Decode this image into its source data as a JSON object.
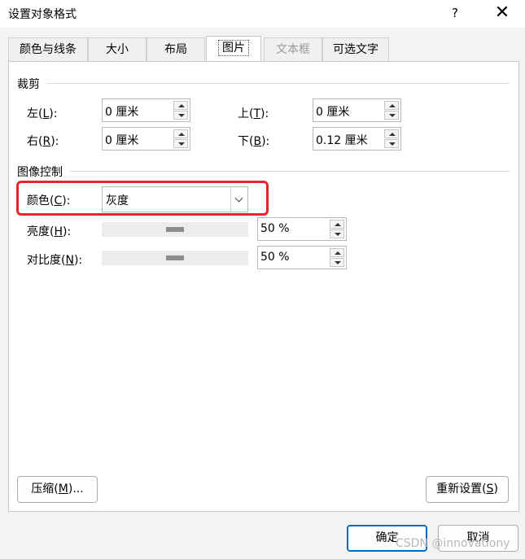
{
  "window": {
    "title": "设置对象格式",
    "help_label": "?",
    "close_label": "✕"
  },
  "tabs": [
    {
      "label": "颜色与线条"
    },
    {
      "label": "大小"
    },
    {
      "label": "布局"
    },
    {
      "label": "图片",
      "active": true
    },
    {
      "label": "文本框",
      "disabled": true
    },
    {
      "label": "可选文字"
    }
  ],
  "crop": {
    "section_title": "裁剪",
    "left": {
      "label_pre": "左(",
      "key": "L",
      "label_post": "):",
      "value": "0 厘米"
    },
    "right": {
      "label_pre": "右(",
      "key": "R",
      "label_post": "):",
      "value": "0 厘米"
    },
    "top": {
      "label_pre": "上(",
      "key": "T",
      "label_post": "):",
      "value": "0 厘米"
    },
    "bottom": {
      "label_pre": "下(",
      "key": "B",
      "label_post": "):",
      "value": "0.12 厘米"
    }
  },
  "image_control": {
    "section_title": "图像控制",
    "color": {
      "label_pre": "颜色(",
      "key": "C",
      "label_post": "):",
      "value": "灰度"
    },
    "brightness": {
      "label_pre": "亮度(",
      "key": "H",
      "label_post": "):",
      "value": "50 %",
      "level": 0.5
    },
    "contrast": {
      "label_pre": "对比度(",
      "key": "N",
      "label_post": "):",
      "value": "50 %",
      "level": 0.5
    }
  },
  "buttons": {
    "compress": {
      "pre": "压缩(",
      "key": "M",
      "post": ")..."
    },
    "reset": {
      "pre": "重新设置(",
      "key": "S",
      "post": ")"
    },
    "ok": "确定",
    "cancel": "取消"
  },
  "watermark": "CSDN @innovationy",
  "colors": {
    "highlight": "#e8242a",
    "primary_border": "#0067c0"
  }
}
